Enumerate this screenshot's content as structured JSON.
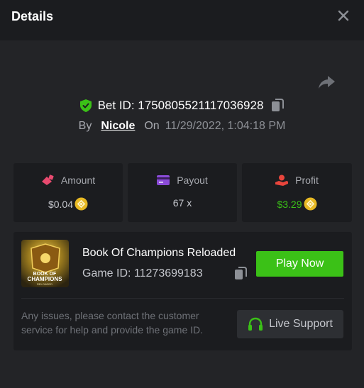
{
  "header": {
    "title": "Details"
  },
  "bet": {
    "id_text": "Bet ID: 1750805521117036928",
    "by_label": "By",
    "user": "Nicole",
    "on_label": "On",
    "datetime": "11/29/2022, 1:04:18 PM"
  },
  "stats": {
    "amount": {
      "label": "Amount",
      "value": "$0.04",
      "icon": "amount-icon",
      "color": "#e84a6f"
    },
    "payout": {
      "label": "Payout",
      "value": "67 x",
      "icon": "card-icon",
      "color": "#8b4bd8"
    },
    "profit": {
      "label": "Profit",
      "value": "$3.29",
      "icon": "profit-icon",
      "color": "#e8453c",
      "value_color": "#3bc117"
    }
  },
  "game": {
    "name": "Book Of Champions Reloaded",
    "id_text": "Game ID: 11273699183",
    "thumb_line1": "BOOK OF",
    "thumb_line2": "CHAMPIONS",
    "thumb_line3": "RELOADED",
    "play_label": "Play Now",
    "help_text": "Any issues, please contact the customer service for help and provide the game ID.",
    "support_label": "Live Support"
  },
  "colors": {
    "accent_green": "#3bc117",
    "panel": "#1b1c1f",
    "background": "#232427"
  }
}
